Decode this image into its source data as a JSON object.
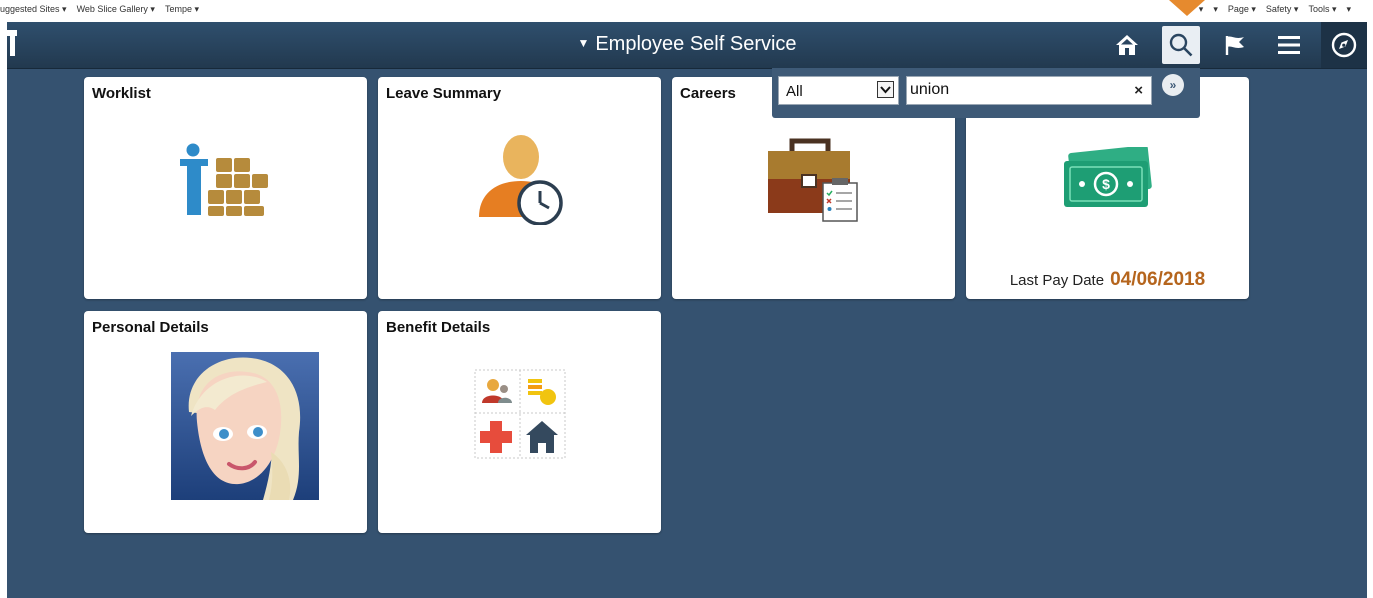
{
  "browser": {
    "favorites": [
      "uggested Sites ▾",
      "Web Slice Gallery ▾",
      "Tempe ▾"
    ],
    "commands": [
      "▾",
      "▾",
      "Page ▾",
      "Safety ▾",
      "Tools ▾",
      "▾"
    ]
  },
  "header": {
    "title": "Employee Self Service",
    "icons": [
      "home-icon",
      "search-icon",
      "flag-icon",
      "menu-icon",
      "navbar-compass-icon"
    ]
  },
  "search": {
    "category": "All",
    "query": "union",
    "clear_label": "×",
    "go_label": "»"
  },
  "tiles": [
    {
      "title": "Worklist",
      "icon": "worklist-icon"
    },
    {
      "title": "Leave Summary",
      "icon": "leave-clock-icon"
    },
    {
      "title": "Careers",
      "icon": "briefcase-icon"
    },
    {
      "title": "",
      "icon": "money-icon",
      "pay_label": "Last Pay Date",
      "pay_date": "04/06/2018"
    },
    {
      "title": "Personal Details",
      "icon": "profile-photo"
    },
    {
      "title": "Benefit Details",
      "icon": "benefits-grid-icon"
    }
  ],
  "colors": {
    "accent": "#355270",
    "banner": "#2a4560",
    "pay_date": "#b5651d",
    "active_pointer": "#e68a2e"
  }
}
